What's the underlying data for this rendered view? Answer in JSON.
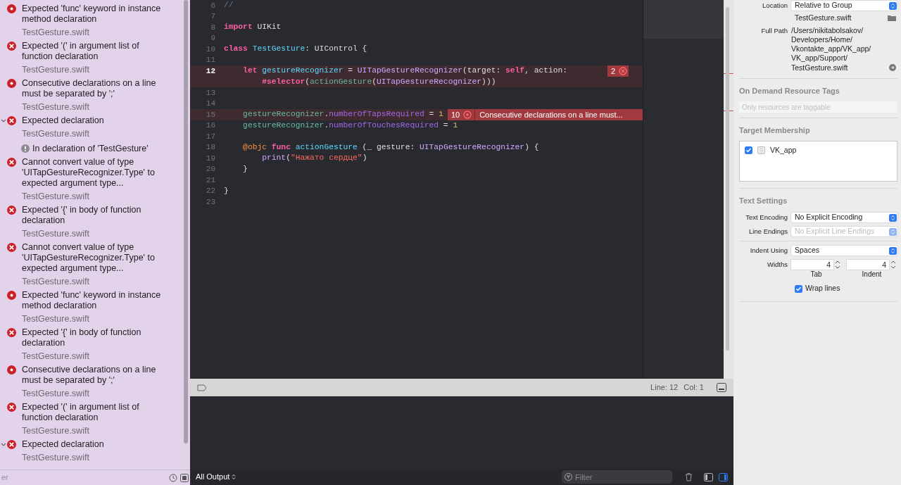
{
  "navigator": {
    "issues": [
      {
        "kind": "fixit",
        "title": "Expected 'func' keyword in instance method declaration",
        "file": "TestGesture.swift"
      },
      {
        "kind": "error",
        "title": "Expected '(' in argument list of function declaration",
        "file": "TestGesture.swift"
      },
      {
        "kind": "fixit",
        "title": "Consecutive declarations on a line must be separated by ';'",
        "file": "TestGesture.swift"
      },
      {
        "kind": "error",
        "title": "Expected declaration",
        "file": "TestGesture.swift",
        "expanded": true,
        "children": [
          {
            "kind": "note",
            "title": "In declaration of 'TestGesture'"
          }
        ]
      },
      {
        "kind": "error",
        "title": "Cannot convert value of type 'UITapGestureRecognizer.Type' to expected argument type...",
        "file": "TestGesture.swift"
      },
      {
        "kind": "error",
        "title": "Expected '{' in body of function declaration",
        "file": "TestGesture.swift"
      },
      {
        "kind": "error",
        "title": "Cannot convert value of type 'UITapGestureRecognizer.Type' to expected argument type...",
        "file": "TestGesture.swift"
      },
      {
        "kind": "fixit",
        "title": "Expected 'func' keyword in instance method declaration",
        "file": "TestGesture.swift"
      },
      {
        "kind": "error",
        "title": "Expected '{' in body of function declaration",
        "file": "TestGesture.swift"
      },
      {
        "kind": "fixit",
        "title": "Consecutive declarations on a line must be separated by ';'",
        "file": "TestGesture.swift"
      },
      {
        "kind": "error",
        "title": "Expected '(' in argument list of function declaration",
        "file": "TestGesture.swift"
      },
      {
        "kind": "error",
        "title": "Expected declaration",
        "file": "TestGesture.swift",
        "expanded": true
      }
    ],
    "filter": {
      "placeholder": "er"
    }
  },
  "editor": {
    "lines": [
      {
        "number": "6",
        "current": false,
        "rows": [
          {
            "tokens": [
              {
                "kind": "comment",
                "text": "//"
              }
            ]
          }
        ]
      },
      {
        "number": "7",
        "current": false,
        "rows": [
          {
            "tokens": []
          }
        ]
      },
      {
        "number": "8",
        "current": false,
        "rows": [
          {
            "tokens": [
              {
                "kind": "keyword",
                "text": "import"
              },
              {
                "kind": "plain",
                "text": " UIKit"
              }
            ]
          }
        ]
      },
      {
        "number": "9",
        "current": false,
        "rows": [
          {
            "tokens": []
          }
        ]
      },
      {
        "number": "10",
        "current": false,
        "rows": [
          {
            "tokens": [
              {
                "kind": "keyword",
                "text": "class "
              },
              {
                "kind": "decl",
                "text": "TestGesture"
              },
              {
                "kind": "plain",
                "text": ": UIControl {"
              }
            ]
          }
        ]
      },
      {
        "number": "11",
        "current": false,
        "rows": [
          {
            "tokens": []
          }
        ]
      },
      {
        "number": "12",
        "current": true,
        "issue": {
          "kind": "error",
          "count": "2"
        },
        "rows": [
          {
            "tokens": [
              {
                "kind": "keyword",
                "text": "    let "
              },
              {
                "kind": "decl",
                "text": "gestureRecognizer"
              },
              {
                "kind": "plain",
                "text": " = "
              },
              {
                "kind": "type",
                "text": "UITapGestureRecognizer"
              },
              {
                "kind": "plain",
                "text": "(target: "
              },
              {
                "kind": "keyword",
                "text": "self"
              },
              {
                "kind": "plain",
                "text": ", action:"
              }
            ]
          },
          {
            "tokens": [
              {
                "kind": "keyword",
                "text": "        #selector"
              },
              {
                "kind": "plain",
                "text": "("
              },
              {
                "kind": "member",
                "text": "actionGesture"
              },
              {
                "kind": "plain",
                "text": "("
              },
              {
                "kind": "type",
                "text": "UITapGestureRecognizer"
              },
              {
                "kind": "plain",
                "text": ")))"
              }
            ]
          }
        ]
      },
      {
        "number": "13",
        "current": false,
        "rows": [
          {
            "tokens": []
          }
        ]
      },
      {
        "number": "14",
        "current": false,
        "rows": [
          {
            "tokens": []
          }
        ]
      },
      {
        "number": "15",
        "current": false,
        "issue": {
          "kind": "fixit",
          "count": "10",
          "message": "Consecutive declarations on a line must..."
        },
        "rows": [
          {
            "tokens": [
              {
                "kind": "member",
                "text": "    gestureRecognizer"
              },
              {
                "kind": "plain",
                "text": "."
              },
              {
                "kind": "property",
                "text": "numberOfTapsRequired"
              },
              {
                "kind": "plain",
                "text": " = "
              },
              {
                "kind": "number",
                "text": "1"
              }
            ]
          }
        ]
      },
      {
        "number": "16",
        "current": false,
        "rows": [
          {
            "tokens": [
              {
                "kind": "member",
                "text": "    gestureRecognizer"
              },
              {
                "kind": "plain",
                "text": "."
              },
              {
                "kind": "property",
                "text": "numberOfTouchesRequired"
              },
              {
                "kind": "plain",
                "text": " = "
              },
              {
                "kind": "number",
                "text": "1"
              }
            ]
          }
        ]
      },
      {
        "number": "17",
        "current": false,
        "rows": [
          {
            "tokens": []
          }
        ]
      },
      {
        "number": "18",
        "current": false,
        "rows": [
          {
            "tokens": [
              {
                "kind": "attribute",
                "text": "    @objc "
              },
              {
                "kind": "keyword",
                "text": "func "
              },
              {
                "kind": "decl",
                "text": "actionGesture"
              },
              {
                "kind": "plain",
                "text": " (_ gesture: "
              },
              {
                "kind": "type",
                "text": "UITapGestureRecognizer"
              },
              {
                "kind": "plain",
                "text": ") {"
              }
            ]
          }
        ]
      },
      {
        "number": "19",
        "current": false,
        "rows": [
          {
            "tokens": [
              {
                "kind": "type",
                "text": "        print"
              },
              {
                "kind": "plain",
                "text": "("
              },
              {
                "kind": "string",
                "text": "\"Нажато сердце\""
              },
              {
                "kind": "plain",
                "text": ")"
              }
            ]
          }
        ]
      },
      {
        "number": "20",
        "current": false,
        "rows": [
          {
            "tokens": [
              {
                "kind": "plain",
                "text": "    }"
              }
            ]
          }
        ]
      },
      {
        "number": "21",
        "current": false,
        "rows": [
          {
            "tokens": []
          }
        ]
      },
      {
        "number": "22",
        "current": false,
        "rows": [
          {
            "tokens": [
              {
                "kind": "plain",
                "text": "}"
              }
            ]
          }
        ]
      },
      {
        "number": "23",
        "current": false,
        "rows": [
          {
            "tokens": []
          }
        ]
      }
    ]
  },
  "debug_bar": {
    "line": "Line: 12",
    "col": "Col: 1"
  },
  "console": {
    "output_selector": "All Output",
    "filter_placeholder": "Filter"
  },
  "inspector": {
    "location": {
      "label": "Location",
      "value": "Relative to Group"
    },
    "file_name": "TestGesture.swift",
    "full_path": {
      "label": "Full Path",
      "lines": [
        "/Users/nikitabolsakov/",
        "Developers/Home/",
        "Vkontakte_app/VK_app/",
        "VK_app/Support/",
        "TestGesture.swift"
      ]
    },
    "on_demand": {
      "title": "On Demand Resource Tags",
      "placeholder": "Only resources are taggable"
    },
    "target_membership": {
      "title": "Target Membership",
      "targets": [
        {
          "name": "VK_app",
          "checked": true
        }
      ]
    },
    "text_settings": {
      "title": "Text Settings",
      "pickers": [
        {
          "label": "Text Encoding",
          "value": "No Explicit Encoding",
          "disabled": false
        },
        {
          "label": "Line Endings",
          "value": "No Explicit Line Endings",
          "disabled": true
        },
        {
          "label": "Indent Using",
          "value": "Spaces",
          "disabled": false
        }
      ],
      "widths": {
        "label": "Widths",
        "tab": {
          "value": "4",
          "label": "Tab"
        },
        "indent": {
          "value": "4",
          "label": "Indent"
        }
      },
      "wrap_lines": {
        "label": "Wrap lines",
        "checked": true
      }
    }
  }
}
